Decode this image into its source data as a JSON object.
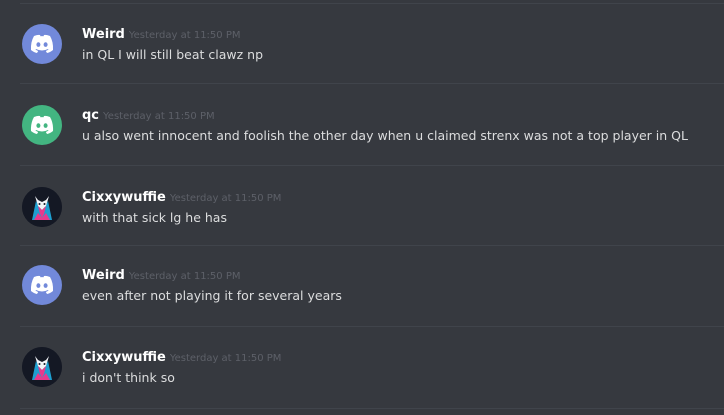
{
  "messages": [
    {
      "username": "Weird",
      "timestamp": "Yesterday at 11:50 PM",
      "text": "in QL I will still beat clawz np",
      "avatar": "discord-blue-icon"
    },
    {
      "username": "qc",
      "timestamp": "Yesterday at 11:50 PM",
      "text": "u also went innocent and foolish the other day when u claimed strenx was not a top player in QL",
      "avatar": "discord-green-icon"
    },
    {
      "username": "Cixxywuffie",
      "timestamp": "Yesterday at 11:50 PM",
      "text": "with that sick lg he has",
      "avatar": "wolf-avatar-icon"
    },
    {
      "username": "Weird",
      "timestamp": "Yesterday at 11:50 PM",
      "text": "even after not playing it for several years",
      "avatar": "discord-blue-icon"
    },
    {
      "username": "Cixxywuffie",
      "timestamp": "Yesterday at 11:50 PM",
      "text": "i don't think so",
      "avatar": "wolf-avatar-icon"
    }
  ],
  "colors": {
    "background": "#36393f",
    "divider": "#40444b",
    "username": "#ffffff",
    "timestamp": "#5d6068",
    "text": "#dcddde",
    "discord_blue": "#7289da",
    "discord_green": "#43b581"
  }
}
